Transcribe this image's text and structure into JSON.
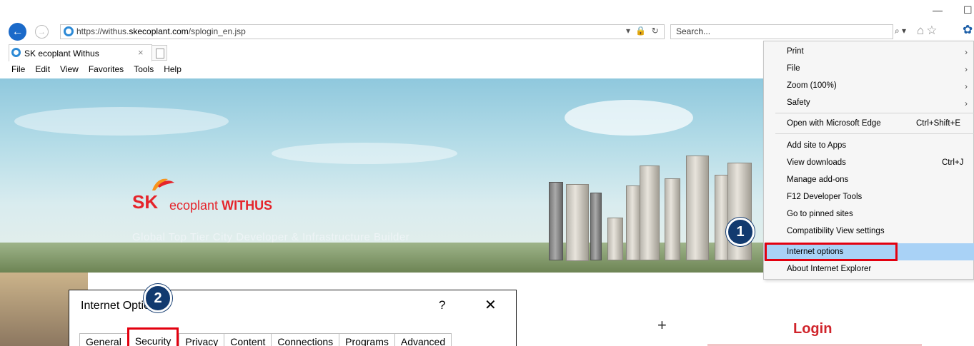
{
  "browser": {
    "url_prefix": "https://withus.",
    "url_domain": "skecoplant.com",
    "url_path": "/splogin_en.jsp",
    "search_placeholder": "Search...",
    "addr_controls": "▾ 🔒 ↻",
    "search_controls": "⌕ ▾",
    "window_min": "—",
    "window_max": "☐"
  },
  "tab": {
    "title": "SK ecoplant Withus",
    "close": "×"
  },
  "menubar": [
    "File",
    "Edit",
    "View",
    "Favorites",
    "Tools",
    "Help"
  ],
  "hero": {
    "logo_sk": "SK",
    "logo_brand": "ecoplant",
    "logo_withus": "WITHUS",
    "tagline": "Global Top Tier City Developer & Infrastructure Builder"
  },
  "page": {
    "plus": "+",
    "login": "Login"
  },
  "dialog": {
    "title": "Internet Options",
    "help": "?",
    "close": "✕",
    "tabs": [
      "General",
      "Security",
      "Privacy",
      "Content",
      "Connections",
      "Programs",
      "Advanced"
    ],
    "active_tab": "Security"
  },
  "menu": {
    "group1": [
      "Print",
      "File",
      "Zoom (100%)",
      "Safety"
    ],
    "edge": "Open with Microsoft Edge",
    "edge_shortcut": "Ctrl+Shift+E",
    "group3": [
      "Add site to Apps",
      "View downloads",
      "Manage add-ons",
      "F12 Developer Tools",
      "Go to pinned sites",
      "Compatibility View settings",
      "Internet options",
      "About Internet Explorer"
    ],
    "downloads_shortcut": "Ctrl+J",
    "highlighted": "Internet options"
  },
  "steps": [
    "1",
    "2"
  ],
  "colors": {
    "accent_red": "#e3000f",
    "badge_navy": "#123a6f",
    "menu_highlight": "#a9d2f6",
    "brand_red": "#e5242b"
  }
}
